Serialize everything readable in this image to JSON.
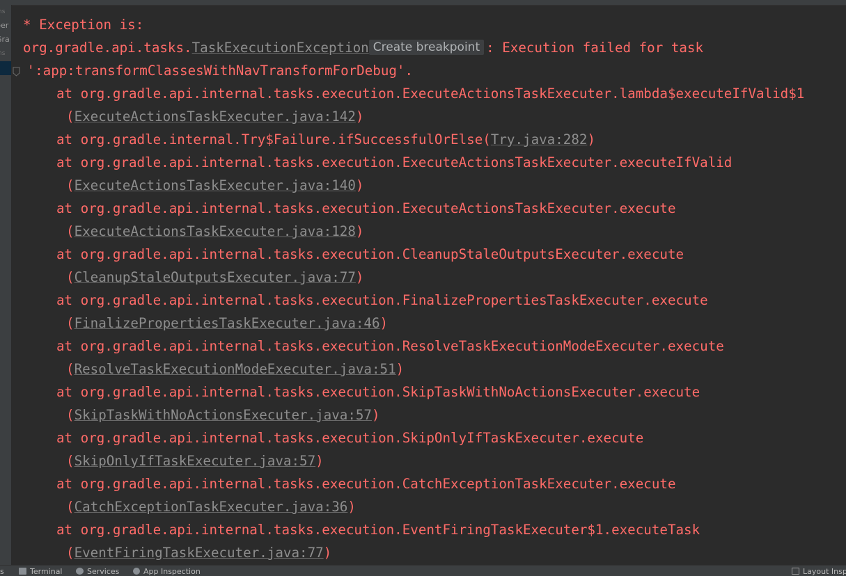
{
  "side_panel": {
    "items": [
      "ms",
      "per",
      "Gra",
      "ms"
    ]
  },
  "console": {
    "header": "* Exception is:",
    "exception_prefix": "org.gradle.api.tasks.",
    "exception_class": "TaskExecutionException",
    "tooltip": "Create breakpoint",
    "exception_suffix": ": Execution failed for task",
    "task_line": " ':app:transformClassesWithNavTransformForDebug'.",
    "frames": [
      {
        "call": "at org.gradle.api.internal.tasks.execution.ExecuteActionsTaskExecuter.lambda$executeIfValid$1",
        "file": "ExecuteActionsTaskExecuter.java:142",
        "wrapped": true
      },
      {
        "call": "at org.gradle.internal.Try$Failure.ifSuccessfulOrElse",
        "file": "Try.java:282",
        "wrapped": false
      },
      {
        "call": "at org.gradle.api.internal.tasks.execution.ExecuteActionsTaskExecuter.executeIfValid",
        "file": "ExecuteActionsTaskExecuter.java:140",
        "wrapped": true
      },
      {
        "call": "at org.gradle.api.internal.tasks.execution.ExecuteActionsTaskExecuter.execute",
        "file": "ExecuteActionsTaskExecuter.java:128",
        "wrapped": true
      },
      {
        "call": "at org.gradle.api.internal.tasks.execution.CleanupStaleOutputsExecuter.execute",
        "file": "CleanupStaleOutputsExecuter.java:77",
        "wrapped": true
      },
      {
        "call": "at org.gradle.api.internal.tasks.execution.FinalizePropertiesTaskExecuter.execute",
        "file": "FinalizePropertiesTaskExecuter.java:46",
        "wrapped": true
      },
      {
        "call": "at org.gradle.api.internal.tasks.execution.ResolveTaskExecutionModeExecuter.execute",
        "file": "ResolveTaskExecutionModeExecuter.java:51",
        "wrapped": true
      },
      {
        "call": "at org.gradle.api.internal.tasks.execution.SkipTaskWithNoActionsExecuter.execute",
        "file": "SkipTaskWithNoActionsExecuter.java:57",
        "wrapped": true
      },
      {
        "call": "at org.gradle.api.internal.tasks.execution.SkipOnlyIfTaskExecuter.execute",
        "file": "SkipOnlyIfTaskExecuter.java:57",
        "wrapped": true
      },
      {
        "call": "at org.gradle.api.internal.tasks.execution.CatchExceptionTaskExecuter.execute",
        "file": "CatchExceptionTaskExecuter.java:36",
        "wrapped": true
      },
      {
        "call": "at org.gradle.api.internal.tasks.execution.EventFiringTaskExecuter$1.executeTask",
        "file": "EventFiringTaskExecuter.java:77",
        "wrapped": true
      }
    ]
  },
  "status_bar": {
    "left_fragment": "s",
    "terminal": "Terminal",
    "services": "Services",
    "app_inspection": "App Inspection",
    "layout_inspector": "Layout Insp"
  },
  "colors": {
    "background": "#2b2b2b",
    "error_text": "#ff6b68",
    "link_text": "#8d8d8d",
    "panel": "#3c3f41"
  },
  "icons": [
    "bookmark-icon",
    "terminal-icon",
    "services-icon",
    "app-inspection-icon",
    "layout-inspector-icon"
  ]
}
